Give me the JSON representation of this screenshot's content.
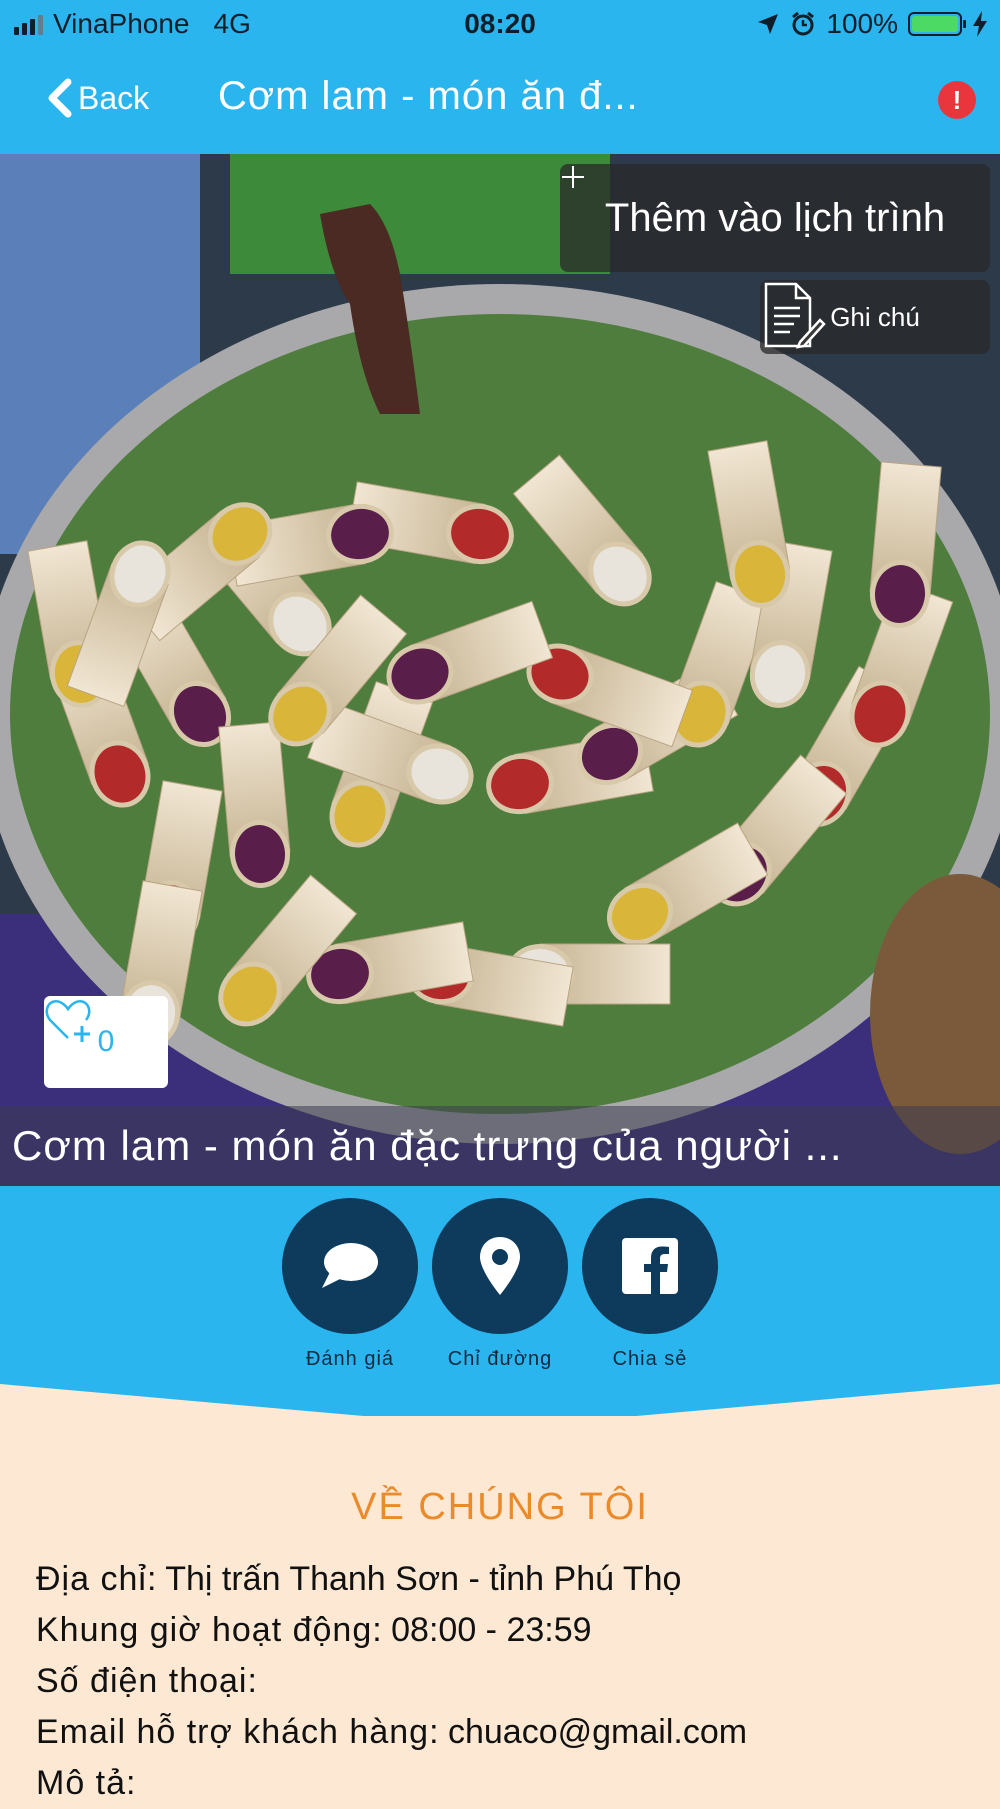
{
  "statusbar": {
    "carrier": "VinaPhone",
    "network": "4G",
    "time": "08:20",
    "battery": "100%",
    "battery_level": 1.0
  },
  "navbar": {
    "back_label": "Back",
    "title": "Cơm lam - món ăn đ...",
    "alert_glyph": "!"
  },
  "hero": {
    "add_schedule_label": "Thêm vào lịch trình",
    "note_label": "Ghi chú",
    "like_count": "0",
    "caption": "Cơm lam - món ăn đặc trưng của người ..."
  },
  "actions": [
    {
      "label": "Đánh giá",
      "icon": "chat-bubble-icon"
    },
    {
      "label": "Chỉ đường",
      "icon": "map-pin-icon"
    },
    {
      "label": "Chia sẻ",
      "icon": "facebook-icon"
    }
  ],
  "about": {
    "heading": "VỀ CHÚNG TÔI",
    "address_key": "Địa chỉ",
    "address_value": "Thị trấn Thanh Sơn - tỉnh Phú Thọ",
    "hours_key": "Khung giờ hoạt động",
    "hours_value": "08:00 - 23:59",
    "phone_key": "Số điện thoại",
    "phone_value": "",
    "email_key": "Email hỗ trợ khách hàng",
    "email_value": "chuaco@gmail.com",
    "desc_key": "Mô tả"
  },
  "colors": {
    "primary": "#2ab5ef",
    "dark_circle": "#0e3a5c",
    "accent": "#ea8a2a",
    "background": "#fde9d3"
  }
}
